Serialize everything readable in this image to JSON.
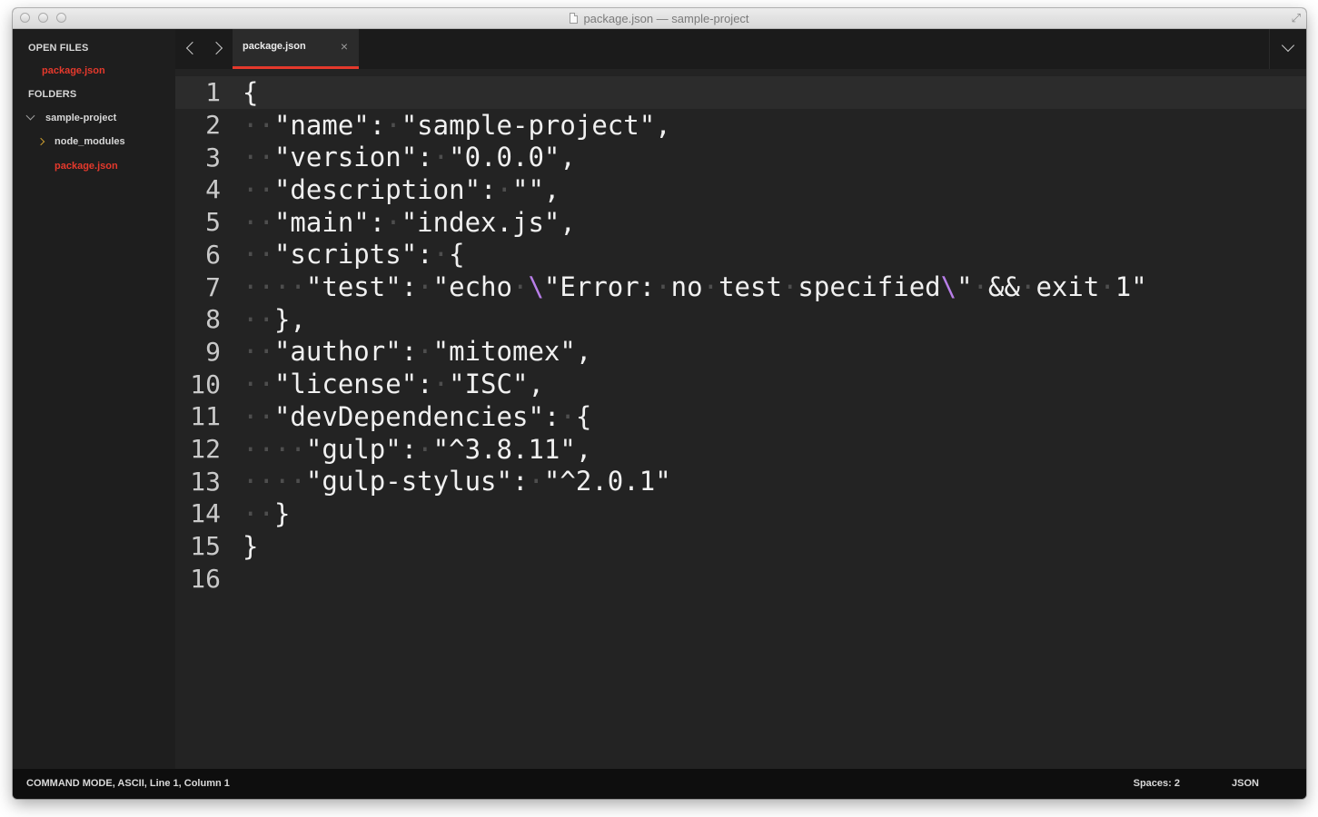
{
  "window": {
    "title": "package.json — sample-project"
  },
  "sidebar": {
    "open_files_header": "OPEN FILES",
    "open_files": [
      "package.json"
    ],
    "folders_header": "FOLDERS",
    "project_folder": "sample-project",
    "subfolder": "node_modules",
    "project_file": "package.json"
  },
  "tabs": [
    {
      "label": "package.json",
      "close_icon": "×",
      "active": true
    }
  ],
  "editor": {
    "line_numbers": [
      "1",
      "2",
      "3",
      "4",
      "5",
      "6",
      "7",
      "8",
      "9",
      "10",
      "11",
      "12",
      "13",
      "14",
      "15",
      "16"
    ],
    "active_line": 1,
    "lines": [
      "{",
      "··\"name\":·\"sample-project\",",
      "··\"version\":·\"0.0.0\",",
      "··\"description\":·\"\",",
      "··\"main\":·\"index.js\",",
      "··\"scripts\":·{",
      "····\"test\":·\"echo·\\\"Error:·no·test·specified\\\"·&&·exit·1\"",
      "··},",
      "··\"author\":·\"mitomex\",",
      "··\"license\":·\"ISC\",",
      "··\"devDependencies\":·{",
      "····\"gulp\":·\"^3.8.11\",",
      "····\"gulp-stylus\":·\"^2.0.1\"",
      "··}",
      "}",
      ""
    ]
  },
  "statusbar": {
    "left": "COMMAND MODE, ASCII, Line 1, Column 1",
    "spaces": "Spaces: 2",
    "syntax": "JSON"
  },
  "colors": {
    "accent": "#e5392c",
    "background": "#232323",
    "escape": "#b87ee8",
    "whitespace": "#4e4e4e"
  }
}
